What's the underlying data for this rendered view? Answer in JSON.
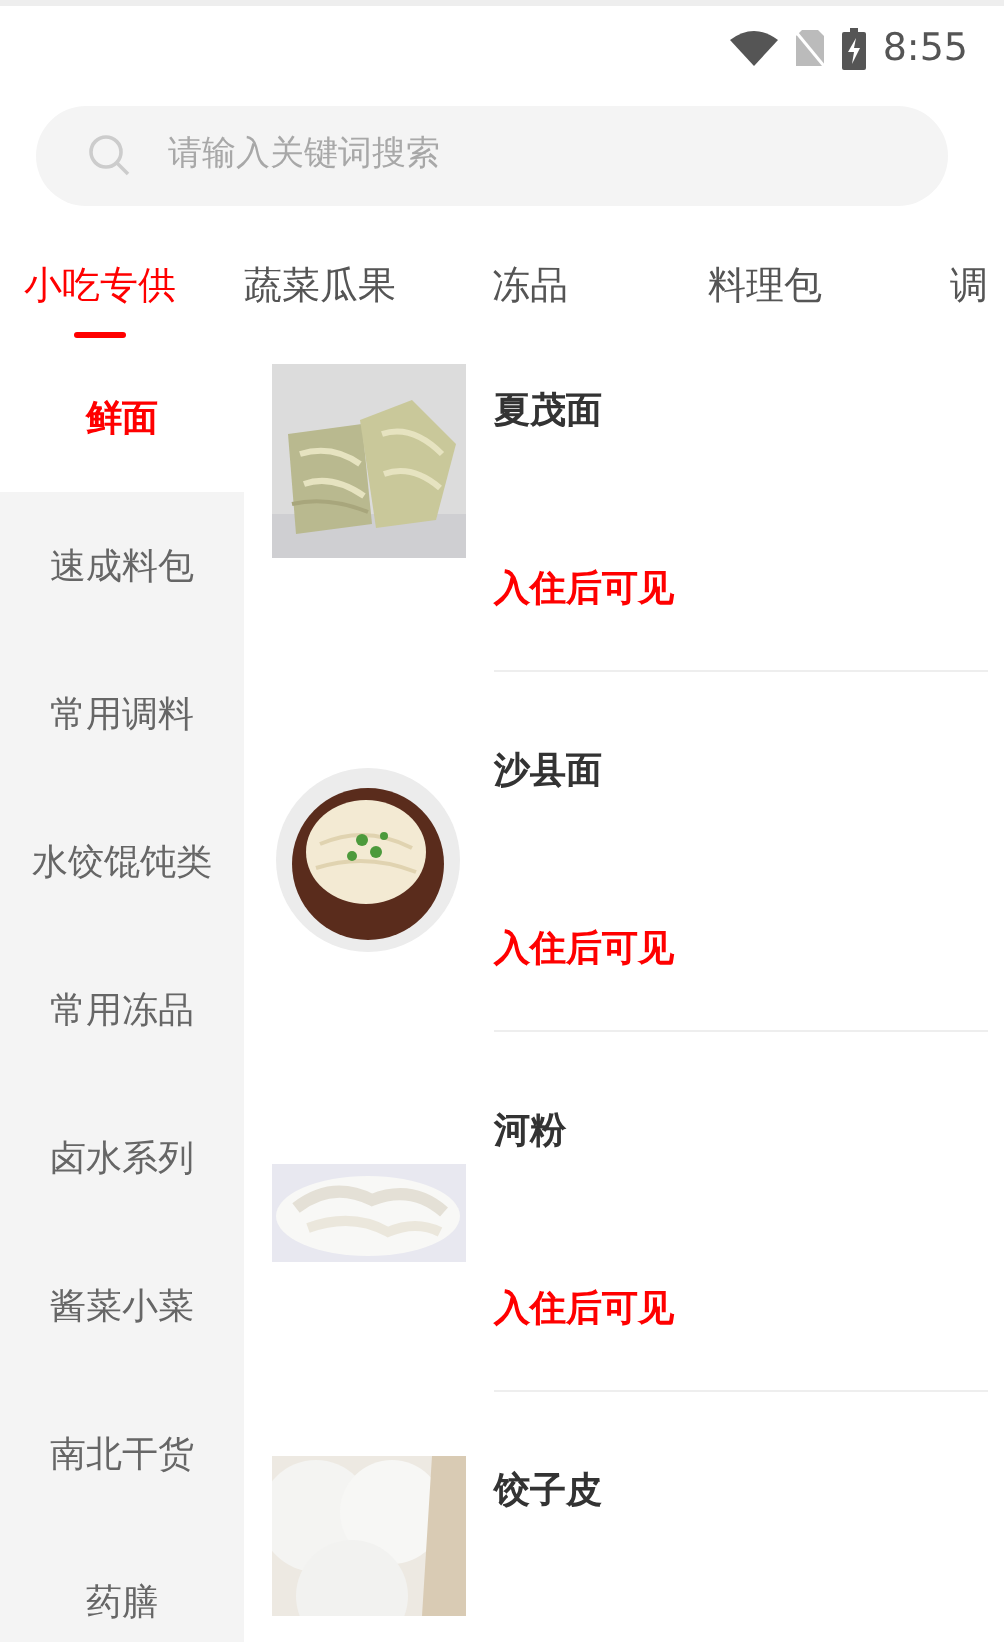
{
  "status_bar": {
    "time": "8:55"
  },
  "search": {
    "placeholder": "请输入关键词搜索"
  },
  "tabs": [
    {
      "label": "小吃专供",
      "selected": true
    },
    {
      "label": "蔬菜瓜果",
      "selected": false
    },
    {
      "label": "冻品",
      "selected": false
    },
    {
      "label": "料理包",
      "selected": false
    },
    {
      "label": "调",
      "selected": false
    }
  ],
  "sidebar": {
    "items": [
      {
        "label": "鲜面",
        "selected": true
      },
      {
        "label": "速成料包",
        "selected": false
      },
      {
        "label": "常用调料",
        "selected": false
      },
      {
        "label": "水饺馄饨类",
        "selected": false
      },
      {
        "label": "常用冻品",
        "selected": false
      },
      {
        "label": "卤水系列",
        "selected": false
      },
      {
        "label": "酱菜小菜",
        "selected": false
      },
      {
        "label": "南北干货",
        "selected": false
      },
      {
        "label": "药膳",
        "selected": false
      }
    ]
  },
  "products": [
    {
      "name": "夏茂面",
      "price": "入住后可见"
    },
    {
      "name": "沙县面",
      "price": "入住后可见"
    },
    {
      "name": "河粉",
      "price": "入住后可见"
    },
    {
      "name": "饺子皮"
    }
  ]
}
